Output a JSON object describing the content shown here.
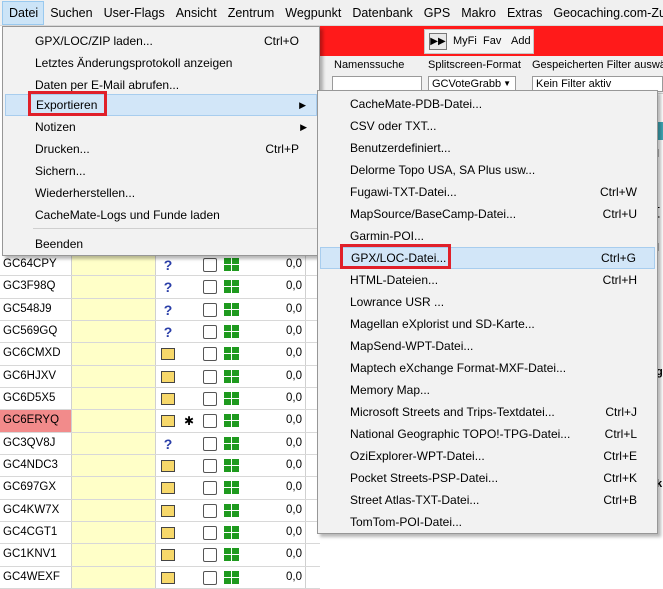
{
  "menubar": {
    "items": [
      "Datei",
      "Suchen",
      "User-Flags",
      "Ansicht",
      "Zentrum",
      "Wegpunkt",
      "Datenbank",
      "GPS",
      "Makro",
      "Extras",
      "Geocaching.com-Zugriff"
    ],
    "active_index": 0
  },
  "favbar": {
    "play_label": "▶▶",
    "myfi": "MyFi",
    "fav": "Fav",
    "add": "Add"
  },
  "filterbar": {
    "name_search_label": "Namenssuche",
    "splitscreen_label": "Splitscreen-Format",
    "splitscreen_value": "GCVoteGrabb",
    "saved_filter_label": "Gespeicherten Filter auswählen",
    "saved_filter_value": "Kein Filter aktiv"
  },
  "datei_menu": {
    "items": [
      {
        "label": "GPX/LOC/ZIP laden...",
        "shortcut": "Ctrl+O"
      },
      {
        "label": "Letztes Änderungsprotokoll anzeigen",
        "shortcut": ""
      },
      {
        "label": "Daten per E-Mail abrufen...",
        "shortcut": ""
      },
      {
        "label": "Exportieren",
        "shortcut": "",
        "submenu": true
      },
      {
        "label": "Notizen",
        "shortcut": "",
        "submenu": true
      },
      {
        "label": "Drucken...",
        "shortcut": "Ctrl+P"
      },
      {
        "label": "Sichern...",
        "shortcut": ""
      },
      {
        "label": "Wiederherstellen...",
        "shortcut": ""
      },
      {
        "label": "CacheMate-Logs und Funde laden",
        "shortcut": ""
      },
      {
        "label": "Beenden",
        "shortcut": ""
      }
    ]
  },
  "export_menu": {
    "items": [
      {
        "label": "CacheMate-PDB-Datei...",
        "shortcut": ""
      },
      {
        "label": "CSV oder TXT...",
        "shortcut": ""
      },
      {
        "label": "Benutzerdefiniert...",
        "shortcut": ""
      },
      {
        "label": "Delorme Topo USA, SA Plus usw...",
        "shortcut": ""
      },
      {
        "label": "Fugawi-TXT-Datei...",
        "shortcut": "Ctrl+W"
      },
      {
        "label": "MapSource/BaseCamp-Datei...",
        "shortcut": "Ctrl+U"
      },
      {
        "label": "Garmin-POI...",
        "shortcut": ""
      },
      {
        "label": "GPX/LOC-Datei...",
        "shortcut": "Ctrl+G"
      },
      {
        "label": "HTML-Dateien...",
        "shortcut": "Ctrl+H"
      },
      {
        "label": "Lowrance USR ...",
        "shortcut": ""
      },
      {
        "label": "Magellan eXplorist und SD-Karte...",
        "shortcut": ""
      },
      {
        "label": "MapSend-WPT-Datei...",
        "shortcut": ""
      },
      {
        "label": "Maptech eXchange Format-MXF-Datei...",
        "shortcut": ""
      },
      {
        "label": "Memory Map...",
        "shortcut": ""
      },
      {
        "label": "Microsoft Streets and Trips-Textdatei...",
        "shortcut": "Ctrl+J"
      },
      {
        "label": "National Geographic TOPO!-TPG-Datei...",
        "shortcut": "Ctrl+L"
      },
      {
        "label": "OziExplorer-WPT-Datei...",
        "shortcut": "Ctrl+E"
      },
      {
        "label": "Pocket Streets-PSP-Datei...",
        "shortcut": "Ctrl+K"
      },
      {
        "label": "Street Atlas-TXT-Datei...",
        "shortcut": "Ctrl+B"
      },
      {
        "label": "TomTom-POI-Datei...",
        "shortcut": ""
      }
    ]
  },
  "grid": {
    "rows": [
      {
        "code": "GC64CPY",
        "icon": "question",
        "value": "0,0"
      },
      {
        "code": "GC3F98Q",
        "icon": "question",
        "value": "0,0"
      },
      {
        "code": "GC548J9",
        "icon": "question",
        "value": "0,0"
      },
      {
        "code": "GC569GQ",
        "icon": "question",
        "value": "0,0"
      },
      {
        "code": "GC6CMXD",
        "icon": "box",
        "value": "0,0"
      },
      {
        "code": "GC6HJXV",
        "icon": "box",
        "value": "0,0"
      },
      {
        "code": "GC6D5X5",
        "icon": "box",
        "value": "0,0"
      },
      {
        "code": "GC6ERYQ",
        "icon": "box",
        "value": "0,0",
        "highlight": true,
        "bug": true
      },
      {
        "code": "GC3QV8J",
        "icon": "question",
        "value": "0,0"
      },
      {
        "code": "GC4NDC3",
        "icon": "box",
        "value": "0,0"
      },
      {
        "code": "GC697GX",
        "icon": "box",
        "value": "0,0"
      },
      {
        "code": "GC4KW7X",
        "icon": "box",
        "value": "0,0"
      },
      {
        "code": "GC4CGT1",
        "icon": "box",
        "value": "0,0"
      },
      {
        "code": "GC1KNV1",
        "icon": "box",
        "value": "0,0"
      },
      {
        "code": "GC4WEXF",
        "icon": "box",
        "value": "0,0"
      }
    ]
  },
  "icons": {
    "question": "question-icon",
    "box": "traditional-cache-icon",
    "bug": "travel-bug-icon",
    "submenu": "chevron-right-icon"
  },
  "colors": {
    "toolbar_red": "#ff1a1a",
    "annotation_red": "#e0202a",
    "highlight_row": "#f28b8b",
    "column_yellow": "#ffffc8"
  }
}
